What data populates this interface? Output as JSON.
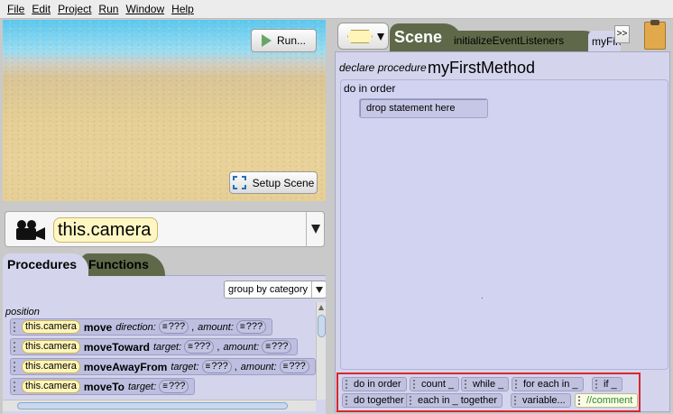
{
  "menu": [
    "File",
    "Edit",
    "Project",
    "Run",
    "Window",
    "Help"
  ],
  "scene_view": {
    "run_label": "Run...",
    "setup_label": "Setup Scene"
  },
  "camera": {
    "label": "this.camera"
  },
  "left_tabs": {
    "procedures": "Procedures",
    "functions": "Functions"
  },
  "group_select": {
    "value": "group by category"
  },
  "section": "position",
  "procedures": [
    {
      "obj": "this.camera",
      "method": "move",
      "p1": "direction:",
      "v1": "???",
      "p2": "amount:",
      "v2": "???"
    },
    {
      "obj": "this.camera",
      "method": "moveToward",
      "p1": "target:",
      "v1": "???",
      "p2": "amount:",
      "v2": "???"
    },
    {
      "obj": "this.camera",
      "method": "moveAwayFrom",
      "p1": "target:",
      "v1": "???",
      "p2": "amount:",
      "v2": "???"
    },
    {
      "obj": "this.camera",
      "method": "moveTo",
      "p1": "target:",
      "v1": "???"
    }
  ],
  "right_tabs": {
    "scene": "Scene",
    "init": "initializeEventListeners",
    "current": "myFirstMethod",
    "more": ">>"
  },
  "editor": {
    "declare_label": "declare procedure",
    "method_name": "myFirstMethod",
    "do_in_order": "do in order",
    "drop_hint": "drop statement here"
  },
  "controls": {
    "row1": [
      "do in order",
      "count _",
      "while _",
      "for each in _",
      "if _"
    ],
    "row2": [
      "do together",
      "each in _ together",
      "variable...",
      "//comment"
    ]
  },
  "colors": {
    "tab_dark": "#5f6949",
    "panel": "#d4d5ec",
    "highlight_border": "#d9262c",
    "object_tile": "#fff5b8"
  }
}
